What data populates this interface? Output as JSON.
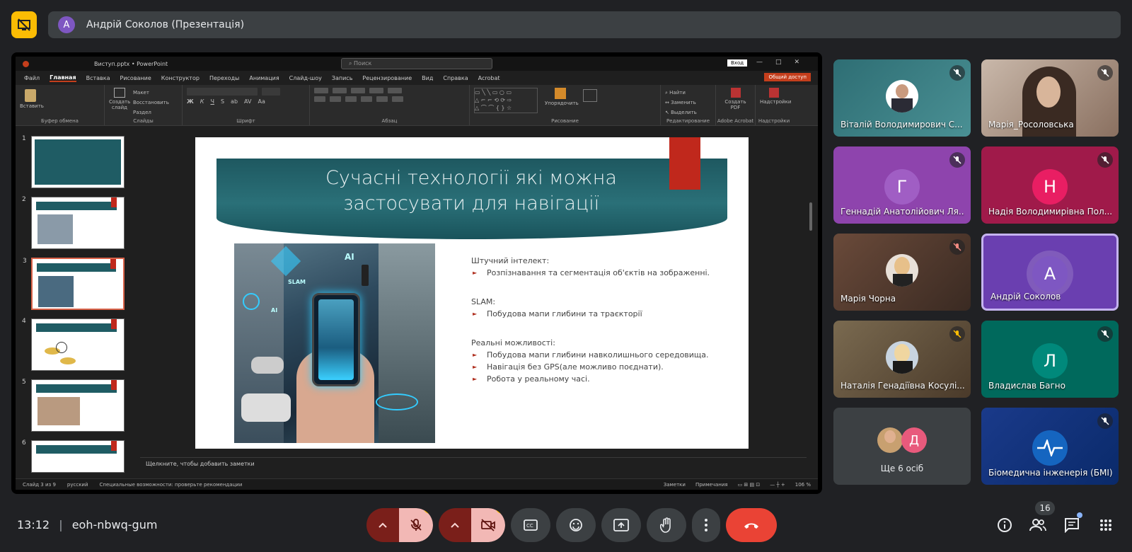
{
  "meeting": {
    "time": "13:12",
    "separator": "|",
    "code": "eoh-nbwq-gum"
  },
  "presenter": {
    "initial": "А",
    "banner": "Андрій Соколов (Презентація)"
  },
  "powerpoint": {
    "filename": "Виступ.pptx",
    "sep": "•",
    "app": "PowerPoint",
    "search_placeholder": "Поиск",
    "signin": "Вход",
    "share": "Общий доступ",
    "tabs": [
      "Файл",
      "Главная",
      "Вставка",
      "Рисование",
      "Конструктор",
      "Переходы",
      "Анимация",
      "Слайд-шоу",
      "Запись",
      "Рецензирование",
      "Вид",
      "Справка",
      "Acrobat"
    ],
    "ribbon": {
      "clipboard": {
        "btn": "Вставить",
        "label": "Буфер обмена"
      },
      "slides": {
        "new": "Создать слайд",
        "layout": "Макет",
        "reset": "Восстановить",
        "section": "Раздел",
        "label": "Слайды"
      },
      "font": {
        "label": "Шрифт"
      },
      "para": {
        "label": "Абзац"
      },
      "draw": {
        "arrange": "Упорядочить",
        "label": "Рисование"
      },
      "edit": {
        "find": "Найти",
        "replace": "Заменить",
        "select": "Выделить",
        "label": "Редактирование"
      },
      "acrobat": {
        "btn": "Создать PDF",
        "label": "Adobe Acrobat"
      },
      "addins": {
        "btn": "Надстройки",
        "label": "Надстройки"
      }
    },
    "thumbs": [
      "1",
      "2",
      "3",
      "4",
      "5",
      "6"
    ],
    "notes_placeholder": "Щелкните, чтобы добавить заметки",
    "status": {
      "slide": "Слайд 3 из 9",
      "lang": "русский",
      "access": "Специальные возможности: проверьте рекомендации",
      "notes": "Заметки",
      "comments": "Примечания",
      "zoom": "106 %"
    }
  },
  "slide": {
    "title_line1": "Сучасні технології які можна",
    "title_line2": "застосувати для навігації",
    "image_labels": {
      "ai": "AI",
      "slam": "SLAM",
      "ai2": "AI"
    },
    "s1_head": "Штучний інтелект:",
    "s1_b1": "Розпізнавання та сегментація об'єктів на зображенні.",
    "s2_head": "SLAM:",
    "s2_b1": "Побудова мапи глибини та траєкторії",
    "s3_head": "Реальні можливості:",
    "s3_b1": "Побудова мапи глибини навколишнього середовища.",
    "s3_b2": "Навігація без GPS(але можливо поєднати).",
    "s3_b3": "Робота у реальному часі."
  },
  "participants": [
    {
      "name": "Віталій Володимирович С..."
    },
    {
      "name": "Марія_Росоловська"
    },
    {
      "name": "Геннадій Анатолійович Ля...",
      "initial": "Г",
      "color": "#b0279b"
    },
    {
      "name": "Надія Володимирівна Пол...",
      "initial": "Н",
      "color": "#e91e63"
    },
    {
      "name": "Марія Чорна"
    },
    {
      "name": "Андрій Соколов",
      "initial": "А",
      "color": "#7e57c2"
    },
    {
      "name": "Наталія Генадіївна Косулі..."
    },
    {
      "name": "Владислав Багно",
      "initial": "Л",
      "color": "#00796b"
    },
    {
      "name": "Ще 6 осіб",
      "initial": "Д",
      "color": "#e85a7c"
    },
    {
      "name": "Біомедична інженерія (БМІ)"
    }
  ],
  "people_count": "16",
  "colors": {
    "accent_yellow": "#fbbc04",
    "end_call": "#ea4335",
    "mic_off_bg": "#f2b8b5",
    "dark_red": "#7a1f1a",
    "slide_banner": "#1e5860",
    "slide_red": "#c0281c"
  }
}
